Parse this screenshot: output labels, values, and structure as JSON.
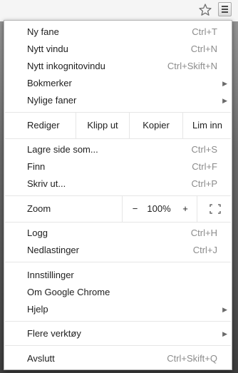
{
  "menu": {
    "items": [
      {
        "label": "Ny fane",
        "shortcut": "Ctrl+T"
      },
      {
        "label": "Nytt vindu",
        "shortcut": "Ctrl+N"
      },
      {
        "label": "Nytt inkognitovindu",
        "shortcut": "Ctrl+Skift+N"
      },
      {
        "label": "Bokmerker",
        "submenu": true
      },
      {
        "label": "Nylige faner",
        "submenu": true
      }
    ],
    "edit": {
      "label": "Rediger",
      "cut": "Klipp ut",
      "copy": "Kopier",
      "paste": "Lim inn"
    },
    "page_items": [
      {
        "label": "Lagre side som...",
        "shortcut": "Ctrl+S"
      },
      {
        "label": "Finn",
        "shortcut": "Ctrl+F"
      },
      {
        "label": "Skriv ut...",
        "shortcut": "Ctrl+P"
      }
    ],
    "zoom": {
      "label": "Zoom",
      "minus": "−",
      "value": "100%",
      "plus": "+"
    },
    "history_items": [
      {
        "label": "Logg",
        "shortcut": "Ctrl+H"
      },
      {
        "label": "Nedlastinger",
        "shortcut": "Ctrl+J"
      }
    ],
    "settings_items": [
      {
        "label": "Innstillinger"
      },
      {
        "label": "Om Google Chrome"
      },
      {
        "label": "Hjelp",
        "submenu": true
      }
    ],
    "tools_item": {
      "label": "Flere verktøy",
      "submenu": true
    },
    "exit_item": {
      "label": "Avslutt",
      "shortcut": "Ctrl+Skift+Q"
    }
  }
}
